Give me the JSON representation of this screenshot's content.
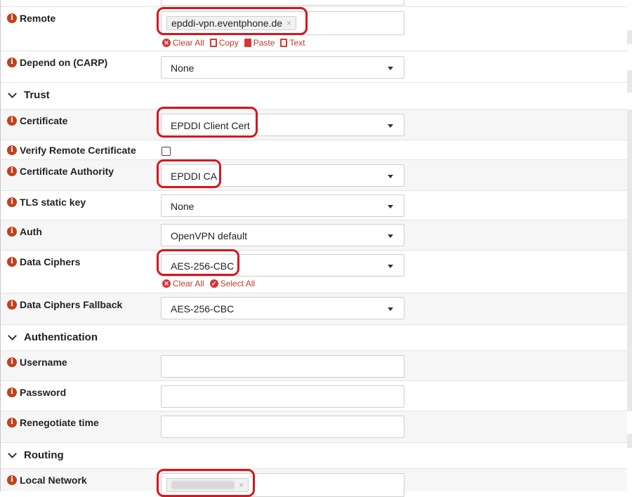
{
  "fields": {
    "remote": {
      "label": "Remote",
      "value": "epddi-vpn.eventphone.de",
      "remove": "×",
      "actions": {
        "clear_all": "Clear All",
        "copy": "Copy",
        "paste": "Paste",
        "text": "Text"
      }
    },
    "depend_on": {
      "label": "Depend on (CARP)",
      "value": "None"
    },
    "certificate": {
      "label": "Certificate",
      "value": "EPDDI Client Cert"
    },
    "verify_remote": {
      "label": "Verify Remote Certificate",
      "checked": false
    },
    "cert_authority": {
      "label": "Certificate Authority",
      "value": "EPDDI CA"
    },
    "tls_key": {
      "label": "TLS static key",
      "value": "None"
    },
    "auth": {
      "label": "Auth",
      "value": "OpenVPN default"
    },
    "data_ciphers": {
      "label": "Data Ciphers",
      "value": "AES-256-CBC",
      "actions": {
        "clear_all": "Clear All",
        "select_all": "Select All"
      }
    },
    "data_ciphers_fallback": {
      "label": "Data Ciphers Fallback",
      "value": "AES-256-CBC"
    },
    "username": {
      "label": "Username",
      "value": ""
    },
    "password": {
      "label": "Password",
      "value": ""
    },
    "renegotiate": {
      "label": "Renegotiate time",
      "value": ""
    },
    "local_network": {
      "label": "Local Network",
      "remove": "×"
    }
  },
  "sections": {
    "trust": "Trust",
    "authentication": "Authentication",
    "routing": "Routing"
  },
  "icons": {
    "info": "i"
  },
  "colors": {
    "info_icon": "#c2411c",
    "highlight": "#d8151d",
    "action_red": "#d33"
  }
}
